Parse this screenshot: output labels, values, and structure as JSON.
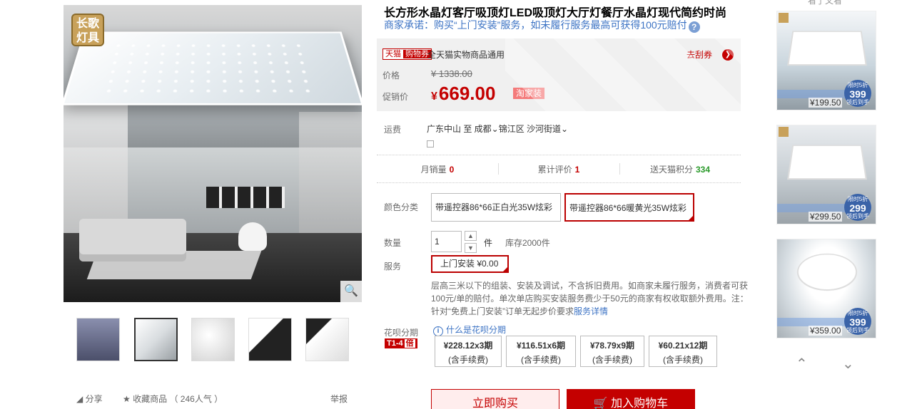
{
  "gallery": {
    "logo_text": "长歌\n灯具",
    "zoom_icon": "magnifier-icon",
    "thumb_count": 5,
    "active_thumb": 2
  },
  "actions": {
    "share": "分享",
    "favorite": "收藏商品",
    "popularity": "（ 246人气 ）",
    "report": "举报"
  },
  "product": {
    "title": "长方形水晶灯客厅吸顶灯LED吸顶灯大厅灯餐厅水晶灯现代简约时尚",
    "promise": "商家承诺：购买“上门安装”服务，如未履行服务最高可获得100元赔付"
  },
  "price_box": {
    "tag_a": "天猫",
    "tag_b": "购物券",
    "coupon_text": "全天猫实物商品通用",
    "coupon_link": "去刮券",
    "price_label": "价格",
    "old_price": "¥ 1338.00",
    "promo_label": "促销价",
    "currency": "¥",
    "sale_price": "669.00",
    "promo_badge": "淘家装"
  },
  "shipping": {
    "label": "运费",
    "value": "广东中山  至  成都⌄锦江区  沙河街道⌄"
  },
  "stats": [
    {
      "label": "月销量",
      "value": "0",
      "color": "#c40000"
    },
    {
      "label": "累计评价",
      "value": "1",
      "color": "#c40000"
    },
    {
      "label": "送天猫积分",
      "value": "334",
      "color": "#2a9a2a"
    }
  ],
  "sku": {
    "label": "颜色分类",
    "options": [
      "带遥控器86*66正白光35W炫彩",
      "带遥控器86*66暖黄光35W炫彩"
    ],
    "selected": 1
  },
  "quantity": {
    "label": "数量",
    "value": "1",
    "unit": "件",
    "stock": "库存2000件"
  },
  "service": {
    "label": "服务",
    "option": "上门安装  ¥0.00",
    "desc": "层高三米以下的组装、安装及调试，不含拆旧费用。如商家未履行服务，消费者可获100元/单的赔付。单次单店购买安装服务费少于50元的商家有权收取额外费用。注：针对“免费上门安装”订单无起步价要求",
    "desc_link": "服务详情"
  },
  "huabei": {
    "label": "花呗分期",
    "badge": "T1-4",
    "badge_x": "倍",
    "what": "什么是花呗分期",
    "plans": [
      {
        "amount": "¥228.12x3期",
        "fee": "(含手续费)"
      },
      {
        "amount": "¥116.51x6期",
        "fee": "(含手续费)"
      },
      {
        "amount": "¥78.79x9期",
        "fee": "(含手续费)"
      },
      {
        "amount": "¥60.21x12期",
        "fee": "(含手续费)"
      }
    ]
  },
  "buttons": {
    "buy_now": "立即购买",
    "add_cart": "加入购物车"
  },
  "sidebar": {
    "heading": "看了又看",
    "items": [
      {
        "price": "¥199.50",
        "badge_top": "限时5折",
        "badge_num": "399",
        "badge_bot": "领后到手"
      },
      {
        "price": "¥299.50",
        "badge_top": "限时5折",
        "badge_num": "299",
        "badge_bot": "领后到手"
      },
      {
        "price": "¥359.00",
        "badge_top": "限时5折",
        "badge_num": "399",
        "badge_bot": "领后到手"
      }
    ],
    "up_icon": "chevron-up-icon",
    "down_icon": "chevron-down-icon"
  }
}
